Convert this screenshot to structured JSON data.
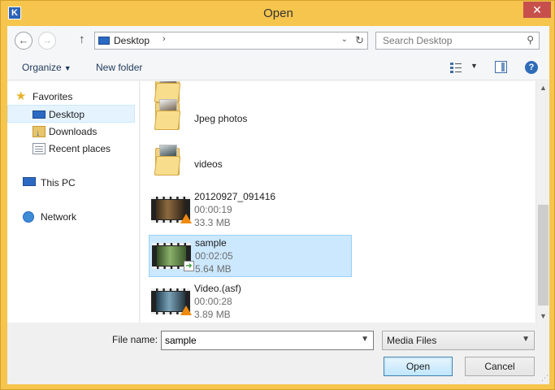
{
  "window": {
    "title": "Open",
    "app_icon_letter": "K",
    "close_glyph": "✕"
  },
  "navigation": {
    "back_glyph": "←",
    "forward_glyph": "→",
    "up_glyph": "↑",
    "address": {
      "location": "Desktop",
      "breadcrumb_chevron": "›",
      "dropdown_glyph": "⌄",
      "refresh_glyph": "↻"
    },
    "search": {
      "placeholder": "Search Desktop",
      "icon_glyph": "⚲"
    }
  },
  "toolbar": {
    "organize_label": "Organize",
    "dropdown_glyph": "▼",
    "new_folder_label": "New folder",
    "help_glyph": "?"
  },
  "sidebar": {
    "favorites": {
      "label": "Favorites",
      "icon": "star-icon"
    },
    "desktop": {
      "label": "Desktop",
      "icon": "desktop-icon"
    },
    "downloads": {
      "label": "Downloads",
      "icon": "downloads-icon"
    },
    "recent_places": {
      "label": "Recent places",
      "icon": "recent-places-icon"
    },
    "this_pc": {
      "label": "This PC",
      "icon": "computer-icon"
    },
    "network": {
      "label": "Network",
      "icon": "network-icon"
    }
  },
  "files": {
    "jpeg_photos": {
      "name": "Jpeg photos",
      "type": "folder"
    },
    "videos": {
      "name": "videos",
      "type": "folder"
    },
    "video1": {
      "name": "20120927_091416",
      "duration": "00:00:19",
      "size": "33.3 MB"
    },
    "sample": {
      "name": "sample",
      "duration": "00:02:05",
      "size": "5.64 MB",
      "selected": true
    },
    "video_asf": {
      "name": "Video.(asf)",
      "duration": "00:00:28",
      "size": "3.89 MB"
    }
  },
  "footer": {
    "file_name_label": "File name:",
    "file_name_value": "sample",
    "file_type": "Media Files",
    "open_label": "Open",
    "cancel_label": "Cancel"
  },
  "colors": {
    "title_bar": "#f6c54d",
    "selection": "#cce8ff",
    "accent": "#2b6ac3"
  }
}
